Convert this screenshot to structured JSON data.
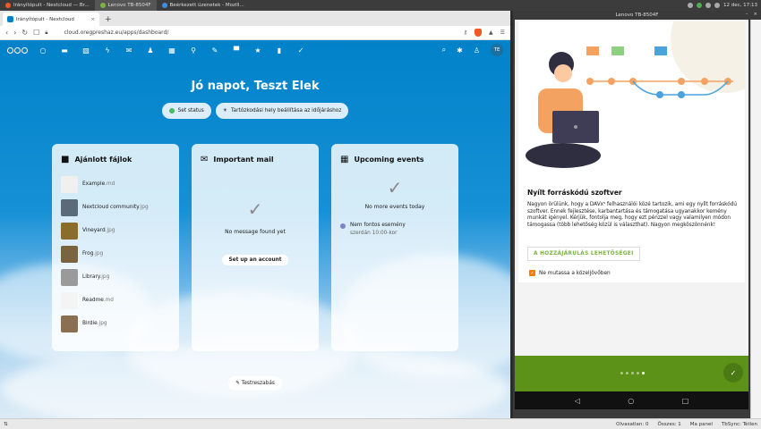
{
  "taskbar": {
    "tasks": [
      "Irányítópult - Nextcloud — Br...",
      "Lenovo TB-8504F",
      "Beérkezett üzenetek - Mozill..."
    ],
    "clock": "12 dec, 17:13"
  },
  "browser": {
    "tab_title": "Irányítópult - Nextcloud",
    "url": "cloud.oregpreshaz.eu/apps/dashboard/"
  },
  "nextcloud": {
    "avatar_initials": "TE",
    "greeting": "Jó napot, Teszt Elek",
    "set_status": "Set status",
    "weather_location": "Tartózkodási hely beállítása az időjáráshoz",
    "files_panel": {
      "title": "Ajánlott fájlok",
      "files": [
        {
          "name": "Example",
          "ext": ".md",
          "color": "#f0f0f0"
        },
        {
          "name": "Nextcloud community",
          "ext": ".jpg",
          "color": "#5a6a78"
        },
        {
          "name": "Vineyard",
          "ext": ".jpg",
          "color": "#8a6d2a"
        },
        {
          "name": "Frog",
          "ext": ".jpg",
          "color": "#7a6440"
        },
        {
          "name": "Library",
          "ext": ".jpg",
          "color": "#9a9a9a"
        },
        {
          "name": "Readme",
          "ext": ".md",
          "color": "#f4f4f4"
        },
        {
          "name": "Birdie",
          "ext": ".jpg",
          "color": "#8a7050"
        }
      ]
    },
    "mail_panel": {
      "title": "Important mail",
      "empty_text": "No message found yet",
      "setup_button": "Set up an account"
    },
    "events_panel": {
      "title": "Upcoming events",
      "empty_text": "No more events today",
      "event_title": "Nem fontos esemény",
      "event_time": "szerdán 10:00-kor"
    },
    "customize_button": "Testreszabás"
  },
  "android": {
    "window_title": "Lenovo TB-8504F",
    "card_title": "Nyílt forráskódú szoftver",
    "card_body": "Nagyon örülünk, hogy a DAVx⁵ felhasználói közé tartozik, ami egy nyílt forráskódú szoftver. Ennek fejlesztése, karbantartása és támogatása ugyanakkor kemény munkát igényel. Kérjük, fontolja meg, hogy ezt pénzzel vagy valamilyen módon támogassa (több lehetőség közül is választhat). Nagyon megköszönnénk!",
    "support_button": "A HOZZÁJÁRULÁS LEHETŐSÉGEI",
    "dont_show_label": "Ne mutassa a közeljövőben",
    "dont_show_checked": true,
    "page_index": 5,
    "page_count": 5
  },
  "statusbar": {
    "unread": "Olvasatlan: 0",
    "total": "Összes: 1",
    "today_panel": "Ma panel",
    "tbsync": "TbSync: Tétlen"
  },
  "colors": {
    "nextcloud_blue": "#0082c9",
    "davx_green": "#5c9217",
    "accent_orange": "#f57c00"
  }
}
